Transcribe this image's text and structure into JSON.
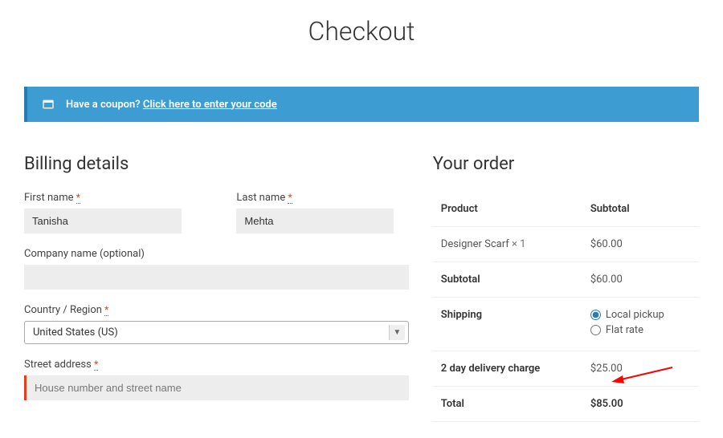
{
  "page_title": "Checkout",
  "coupon": {
    "prompt": "Have a coupon?",
    "link_text": "Click here to enter your code"
  },
  "billing": {
    "heading": "Billing details",
    "first_name_label": "First name",
    "first_name_value": "Tanisha",
    "last_name_label": "Last name",
    "last_name_value": "Mehta",
    "company_label": "Company name (optional)",
    "company_value": "",
    "country_label": "Country / Region",
    "country_value": "United States (US)",
    "street_label": "Street address",
    "street_placeholder": "House number and street name",
    "street_value": ""
  },
  "order": {
    "heading": "Your order",
    "col_product": "Product",
    "col_subtotal": "Subtotal",
    "items": [
      {
        "name": "Designer Scarf",
        "qty": "× 1",
        "subtotal": "$60.00"
      }
    ],
    "subtotal_label": "Subtotal",
    "subtotal_value": "$60.00",
    "shipping_label": "Shipping",
    "shipping_options": [
      {
        "label": "Local pickup",
        "selected": true
      },
      {
        "label": "Flat rate",
        "selected": false
      }
    ],
    "fee_label": "2 day delivery charge",
    "fee_value": "$25.00",
    "total_label": "Total",
    "total_value": "$85.00"
  },
  "required_glyph": "*"
}
